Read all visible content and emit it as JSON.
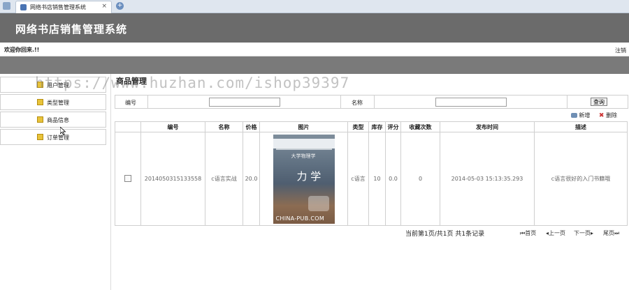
{
  "browser": {
    "tab_title": "网络书店销售管理系统",
    "close_glyph": "×",
    "new_tab_glyph": "+"
  },
  "header": {
    "title": "网络书店销售管理系统"
  },
  "welcome_bar": {
    "welcome_text": "欢迎你回来.!!",
    "logout_label": "注销"
  },
  "sidebar": {
    "items": [
      {
        "label": "用户管理"
      },
      {
        "label": "类型管理"
      },
      {
        "label": "商品信息"
      },
      {
        "label": "订单管理"
      }
    ]
  },
  "main": {
    "section_title": "商品管理",
    "search": {
      "number_label": "编号",
      "number_value": "",
      "name_label": "名称",
      "name_value": "",
      "query_button": "查询"
    },
    "actions": {
      "add_label": "新增",
      "delete_label": "删除"
    },
    "table": {
      "headers": [
        "",
        "编号",
        "名称",
        "价格",
        "图片",
        "类型",
        "库存",
        "评分",
        "收藏次数",
        "发布时间",
        "描述"
      ],
      "rows": [
        {
          "number": "2014050315133558",
          "name": "c语言实战",
          "price": "20.0",
          "cover": {
            "line1": "大学物理学",
            "line2": "力 学",
            "publisher_mark": "CHINA-PUB.COM"
          },
          "type": "c语言",
          "stock": "10",
          "score": "0.0",
          "favorites": "0",
          "publish_time": "2014-05-03 15:13:35.293",
          "description": "c语言很好的入门书籍哦"
        }
      ]
    },
    "pager": {
      "info": "当前第1页/共1页    共1条记录",
      "first": "首页",
      "prev": "上一页",
      "next": "下一页",
      "last": "尾页"
    }
  },
  "watermark": "https://www.huzhan.com/ishop39397",
  "colors": {
    "header_bg": "#6b6b6b",
    "nav_bg": "#7a7a7a",
    "border": "#cfcfcf"
  }
}
